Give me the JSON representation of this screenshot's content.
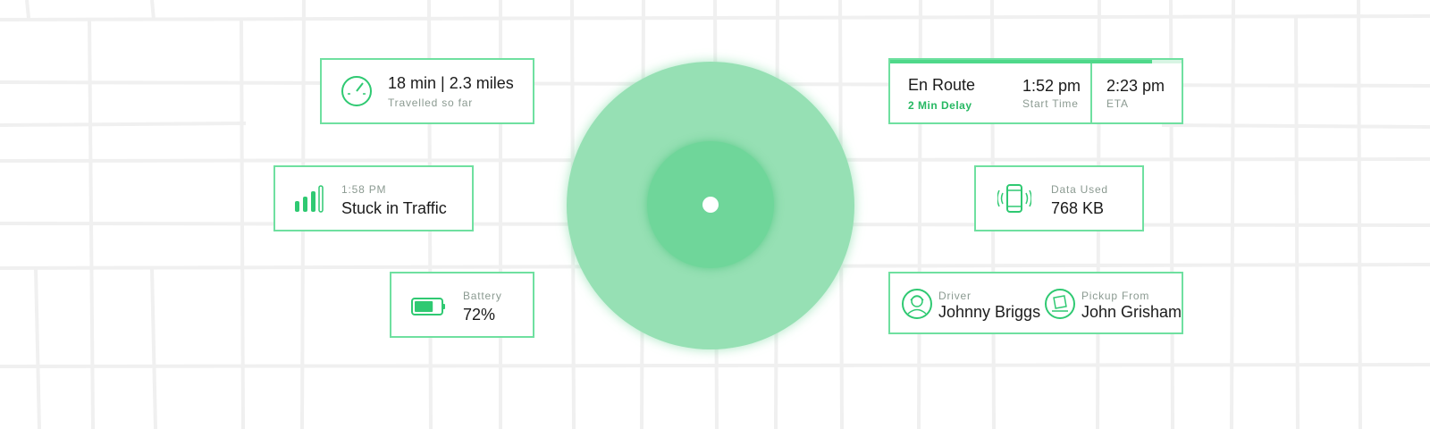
{
  "colors": {
    "accent": "#4fd88a",
    "accent_dark": "#27b863",
    "outer_circle": "#96e0b4",
    "inner_circle": "#6fd69a"
  },
  "distance_card": {
    "icon": "speedometer-icon",
    "value": "18 min | 2.3 miles",
    "label": "Travelled so far"
  },
  "traffic_card": {
    "icon": "signal-bars-icon",
    "time": "1:58 PM",
    "status": "Stuck in Traffic"
  },
  "battery_card": {
    "icon": "battery-icon",
    "label": "Battery",
    "value": "72%",
    "level": 0.72
  },
  "trip_card": {
    "progress": 0.9,
    "status": "En Route",
    "delay": "2 Min Delay",
    "start_time": "1:52 pm",
    "start_label": "Start Time",
    "eta": "2:23 pm",
    "eta_label": "ETA"
  },
  "data_card": {
    "icon": "phone-vibrate-icon",
    "label": "Data Used",
    "value": "768 KB"
  },
  "people_card": {
    "driver_icon": "driver-avatar-icon",
    "driver_label": "Driver",
    "driver_name": "Johnny Briggs",
    "pickup_icon": "package-icon",
    "pickup_label": "Pickup From",
    "pickup_name": "John Grisham"
  }
}
